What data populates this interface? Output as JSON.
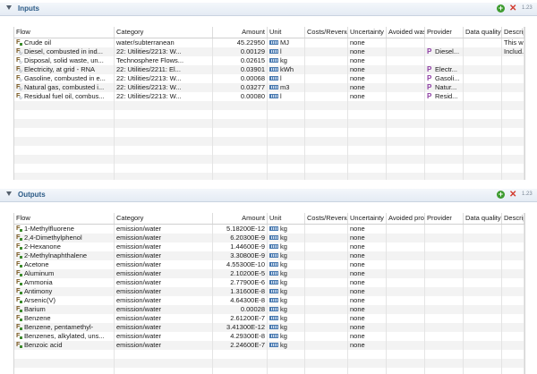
{
  "sections": {
    "inputs": {
      "title": "Inputs",
      "format_label": "1.23"
    },
    "outputs": {
      "title": "Outputs",
      "format_label": "1.23"
    }
  },
  "inputs_headers": [
    "Flow",
    "Category",
    "Amount",
    "Unit",
    "Costs/Revenue",
    "Uncertainty",
    "Avoided waste",
    "Provider",
    "Data quality",
    "Description"
  ],
  "outputs_headers": [
    "Flow",
    "Category",
    "Amount",
    "Unit",
    "Costs/Revenue",
    "Uncertainty",
    "Avoided product",
    "Provider",
    "Data quality",
    "Description"
  ],
  "inputs": [
    {
      "flow": "Crude oil",
      "icon": "flow",
      "category": "water/subterranean",
      "amount": "45.22950",
      "unit": "MJ",
      "uncertainty": "none",
      "provider": "",
      "description": "This w..."
    },
    {
      "flow": "Diesel, combusted in ind...",
      "icon": "prod",
      "category": "22: Utilities/2213: W...",
      "amount": "0.00129",
      "unit": "l",
      "uncertainty": "none",
      "provider": "Diesel...",
      "description": "Includ..."
    },
    {
      "flow": "Disposal, solid waste, un...",
      "icon": "prod",
      "category": "Technosphere Flows...",
      "amount": "0.02615",
      "unit": "kg",
      "uncertainty": "none",
      "provider": "",
      "description": ""
    },
    {
      "flow": "Electricity, at grid - RNA",
      "icon": "prod",
      "category": "22: Utilities/2211: El...",
      "amount": "0.03901",
      "unit": "kWh",
      "uncertainty": "none",
      "provider": "Electr...",
      "description": ""
    },
    {
      "flow": "Gasoline, combusted in e...",
      "icon": "prod",
      "category": "22: Utilities/2213: W...",
      "amount": "0.00068",
      "unit": "l",
      "uncertainty": "none",
      "provider": "Gasoli...",
      "description": ""
    },
    {
      "flow": "Natural gas, combusted i...",
      "icon": "prod",
      "category": "22: Utilities/2213: W...",
      "amount": "0.03277",
      "unit": "m3",
      "uncertainty": "none",
      "provider": "Natur...",
      "description": ""
    },
    {
      "flow": "Residual fuel oil, combus...",
      "icon": "prod",
      "category": "22: Utilities/2213: W...",
      "amount": "0.00080",
      "unit": "l",
      "uncertainty": "none",
      "provider": "Resid...",
      "description": ""
    }
  ],
  "outputs": [
    {
      "flow": "1-Methylfluorene",
      "category": "emission/water",
      "amount": "5.18200E-12",
      "unit": "kg",
      "uncertainty": "none"
    },
    {
      "flow": "2,4-Dimethylphenol",
      "category": "emission/water",
      "amount": "6.20300E-9",
      "unit": "kg",
      "uncertainty": "none"
    },
    {
      "flow": "2-Hexanone",
      "category": "emission/water",
      "amount": "1.44600E-9",
      "unit": "kg",
      "uncertainty": "none"
    },
    {
      "flow": "2-Methylnaphthalene",
      "category": "emission/water",
      "amount": "3.30800E-9",
      "unit": "kg",
      "uncertainty": "none"
    },
    {
      "flow": "Acetone",
      "category": "emission/water",
      "amount": "4.55300E-10",
      "unit": "kg",
      "uncertainty": "none"
    },
    {
      "flow": "Aluminum",
      "category": "emission/water",
      "amount": "2.10200E-5",
      "unit": "kg",
      "uncertainty": "none"
    },
    {
      "flow": "Ammonia",
      "category": "emission/water",
      "amount": "2.77900E-6",
      "unit": "kg",
      "uncertainty": "none"
    },
    {
      "flow": "Antimony",
      "category": "emission/water",
      "amount": "1.31600E-8",
      "unit": "kg",
      "uncertainty": "none"
    },
    {
      "flow": "Arsenic(V)",
      "category": "emission/water",
      "amount": "4.64300E-8",
      "unit": "kg",
      "uncertainty": "none"
    },
    {
      "flow": "Barium",
      "category": "emission/water",
      "amount": "0.00028",
      "unit": "kg",
      "uncertainty": "none"
    },
    {
      "flow": "Benzene",
      "category": "emission/water",
      "amount": "2.61200E-7",
      "unit": "kg",
      "uncertainty": "none"
    },
    {
      "flow": "Benzene, pentamethyl-",
      "category": "emission/water",
      "amount": "3.41300E-12",
      "unit": "kg",
      "uncertainty": "none"
    },
    {
      "flow": "Benzenes, alkylated, uns...",
      "category": "emission/water",
      "amount": "4.29300E-8",
      "unit": "kg",
      "uncertainty": "none"
    },
    {
      "flow": "Benzoic acid",
      "category": "emission/water",
      "amount": "2.24600E-7",
      "unit": "kg",
      "uncertainty": "none"
    }
  ],
  "colors": {
    "header_title": "#2b5a86",
    "add_icon": "#3d9b2f",
    "remove_icon": "#d23a2e",
    "provider_icon": "#8e3ea4"
  },
  "icons": {
    "add": "plus-circle-icon",
    "remove": "x-icon",
    "flow": "elementary-flow-icon",
    "product": "product-flow-icon",
    "unit": "unit-ruler-icon",
    "provider": "process-p-icon"
  }
}
